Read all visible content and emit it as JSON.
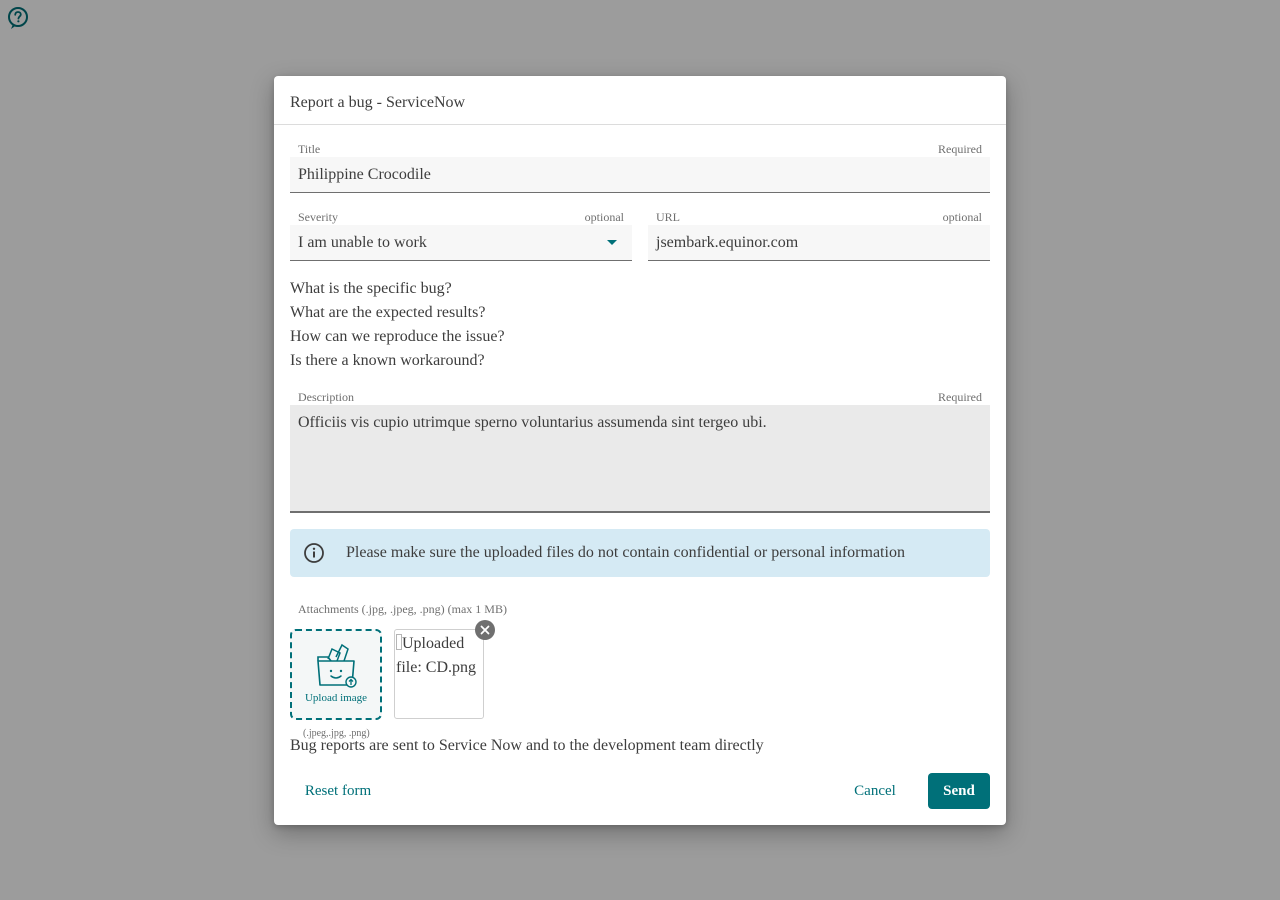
{
  "help": {
    "icon": "help-circle-icon"
  },
  "dialog": {
    "title": "Report a bug - ServiceNow",
    "fields": {
      "title": {
        "label": "Title",
        "meta": "Required",
        "value": "Philippine Crocodile"
      },
      "severity": {
        "label": "Severity",
        "meta": "optional",
        "value": "I am unable to work"
      },
      "url": {
        "label": "URL",
        "meta": "optional",
        "value": "jsembark.equinor.com"
      },
      "description": {
        "label": "Description",
        "meta": "Required",
        "value": "Officiis vis cupio utrimque sperno voluntarius assumenda sint tergeo ubi."
      }
    },
    "questions": [
      "What is the specific bug?",
      "What are the expected results?",
      "How can we reproduce the issue?",
      "Is there a known workaround?"
    ],
    "banner": "Please make sure the uploaded files do not contain confidential or personal information",
    "attachments": {
      "label": "Attachments (.jpg, .jpeg, .png) (max 1 MB)",
      "upload_label": "Upload image",
      "upload_hint": "(.jpeg,.jpg, .png)",
      "file_alt": "Uploaded file: CD.png"
    },
    "footer_note": "Bug reports are sent to Service Now and to the development team directly",
    "buttons": {
      "reset": "Reset form",
      "cancel": "Cancel",
      "send": "Send"
    }
  },
  "colors": {
    "accent": "#007079",
    "overlay": "#9c9c9c",
    "banner_bg": "#d5eaf4",
    "input_bg": "#f7f7f7"
  }
}
